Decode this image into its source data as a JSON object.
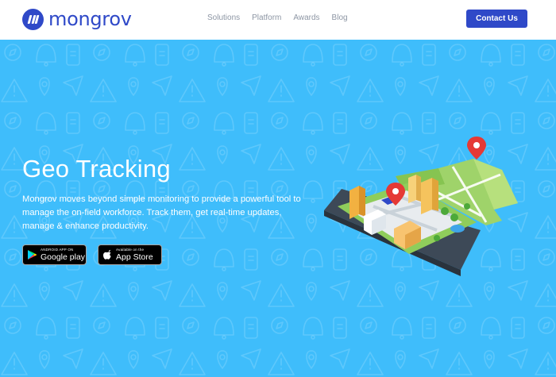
{
  "brand": {
    "name": "mongrov"
  },
  "nav": {
    "items": [
      "Solutions",
      "Platform",
      "Awards",
      "Blog"
    ],
    "cta": "Contact Us"
  },
  "hero": {
    "title": "Geo Tracking",
    "description": "Mongrov moves beyond simple monitoring to provide a powerful tool to manage the on-field workforce. Track them, get real-time updates, manage & enhance productivity.",
    "google_play": {
      "small": "ANDROID APP ON",
      "big": "Google play"
    },
    "app_store": {
      "small": "Available on the",
      "big": "App Store"
    }
  },
  "colors": {
    "brand": "#2f49c8",
    "hero_bg": "#3fbdfb",
    "nav_text": "#8d96a4"
  },
  "icons": [
    "mongrov-logo-icon",
    "google-play-icon",
    "apple-icon",
    "map-pin-icon",
    "phone-map-illustration"
  ]
}
